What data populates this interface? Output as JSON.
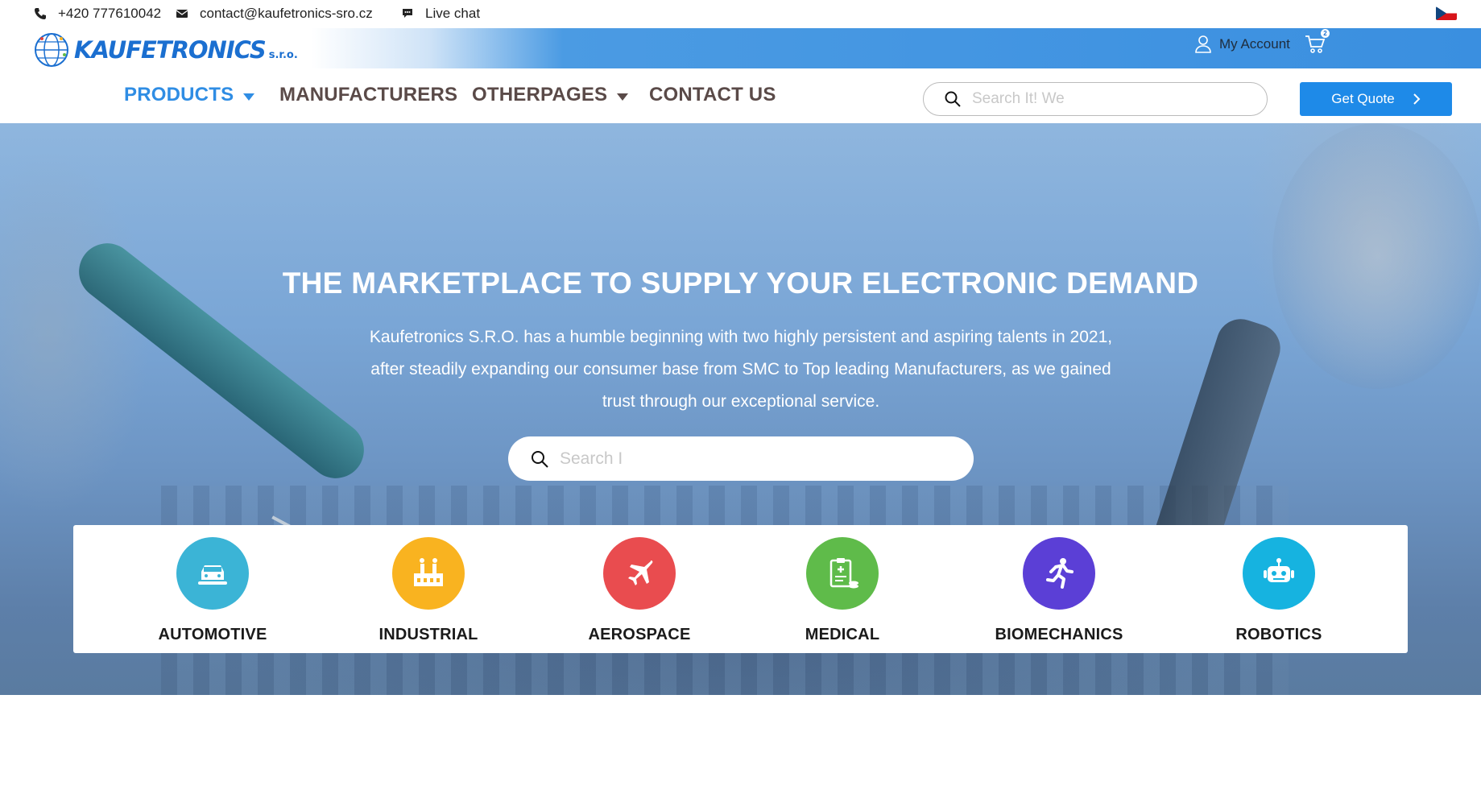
{
  "topbar": {
    "phone": "+420 777610042",
    "email": "contact@kaufetronics-sro.cz",
    "chat": "Live chat"
  },
  "header": {
    "logo_main": "KAUFETRONICS",
    "logo_sub": "s.r.o.",
    "account_label": "My Account",
    "cart_count": "2"
  },
  "nav": {
    "items": [
      {
        "label": "PRODUCTS"
      },
      {
        "label": "MANUFACTURERS"
      },
      {
        "label": "OTHERPAGES"
      },
      {
        "label": "CONTACT US"
      }
    ],
    "search_placeholder": "Search It! We",
    "quote_label": "Get Quote"
  },
  "hero": {
    "title": "THE MARKETPLACE TO SUPPLY YOUR ELECTRONIC DEMAND",
    "desc_line1": "Kaufetronics S.R.O. has a humble beginning with two highly persistent and aspiring talents in 2021,",
    "desc_line2": "after steadily expanding our consumer base from SMC to Top leading Manufacturers, as we gained",
    "desc_line3": "trust through our exceptional service.",
    "search_placeholder": "Search I"
  },
  "categories": [
    {
      "label": "AUTOMOTIVE",
      "color": "#3bb4d6",
      "icon": "car-icon"
    },
    {
      "label": "INDUSTRIAL",
      "color": "#f9b320",
      "icon": "factory-icon"
    },
    {
      "label": "AEROSPACE",
      "color": "#e94c4f",
      "icon": "airplane-icon"
    },
    {
      "label": "MEDICAL",
      "color": "#5fbb4a",
      "icon": "medical-clipboard-icon"
    },
    {
      "label": "BIOMECHANICS",
      "color": "#5b3fd6",
      "icon": "running-person-icon"
    },
    {
      "label": "ROBOTICS",
      "color": "#16b3e0",
      "icon": "robot-icon"
    }
  ],
  "colors": {
    "accent": "#2f8de4",
    "button": "#1e8ae8",
    "nav_text": "#5a4a48"
  }
}
